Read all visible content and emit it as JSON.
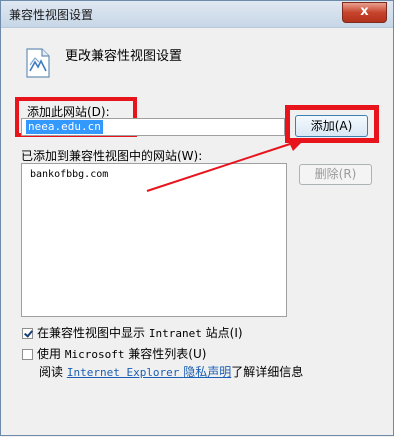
{
  "window": {
    "title": "兼容性视图设置",
    "close_glyph": "x"
  },
  "header": {
    "title": "更改兼容性视图设置"
  },
  "add_site": {
    "label": "添加此网站(D):",
    "input_value": "neea.edu.cn",
    "button_label": "添加(A)"
  },
  "site_list": {
    "label": "已添加到兼容性视图中的网站(W):",
    "items": [
      "bankofbbg.com"
    ],
    "remove_label": "删除(R)"
  },
  "options": {
    "intranet_prefix": "在兼容性视图中显示",
    "intranet_mono": "Intranet",
    "intranet_suffix": "站点(I)",
    "intranet_checked": true,
    "ms_prefix": "使用",
    "ms_mono": "Microsoft",
    "ms_suffix": "兼容性列表(U)",
    "ms_checked": false
  },
  "footer": {
    "prefix": "阅读",
    "link_mono": "Internet Explorer",
    "link_cn": "隐私声明",
    "suffix": "了解详细信息"
  },
  "colors": {
    "highlight_red": "#e8141c",
    "selection_blue": "#3399ff",
    "link_blue": "#1a5fb4"
  }
}
